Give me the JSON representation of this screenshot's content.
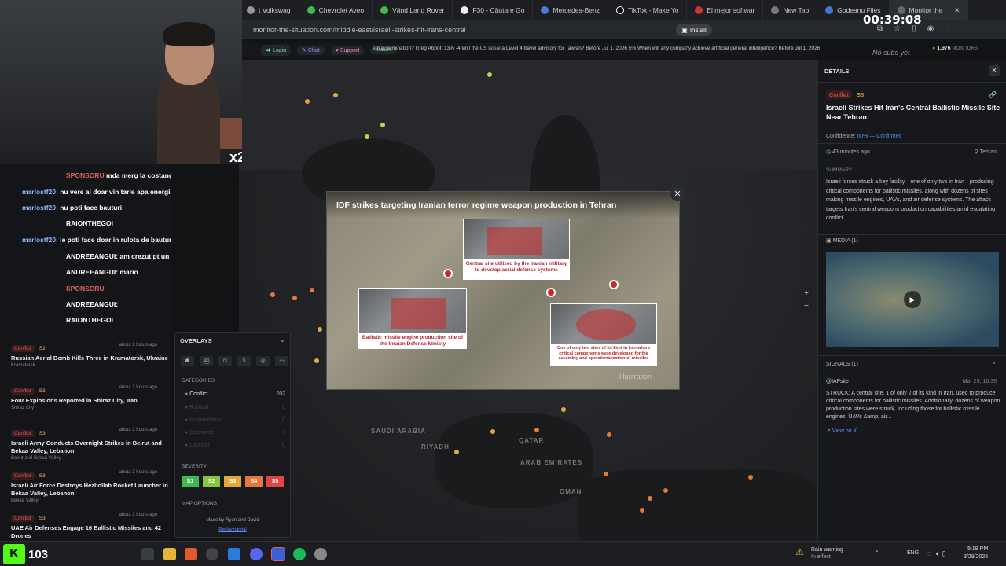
{
  "browser": {
    "tabs": [
      {
        "label": "t Volkswag"
      },
      {
        "label": "Chevrolet Aveo"
      },
      {
        "label": "Vând Land Rover"
      },
      {
        "label": "F30 - Căutare Go"
      },
      {
        "label": "Mercedes-Benz"
      },
      {
        "label": "TikTok - Make Yo"
      },
      {
        "label": "El mejor softwar"
      },
      {
        "label": "New Tab"
      },
      {
        "label": "Godeanu Files"
      },
      {
        "label": "Monitor the"
      }
    ],
    "url": "monitor-the-situation.com/middle-east/israeli-strikes-hit-irans-central",
    "install_label": "Install"
  },
  "stream": {
    "clock": "00:39:08",
    "multiplier": "x2",
    "no_subs": "No subs yet"
  },
  "site_nav": {
    "login": "Login",
    "chat": "Chat",
    "support": "Support",
    "kalshi": "KALSHI",
    "ticker": "ential nomination? Greg Abbott 13% -4   Will the US issue a Level 4 travel advisory for Taiwan? Before Jul 1, 2026 5%   When will any company achieve artificial general intelligence? Before Jul 1, 2026",
    "monitors_count": "1,976",
    "monitors_label": "MONITORS"
  },
  "chat": [
    {
      "user": "SPONSORU",
      "text": "mda merg la costangeles"
    },
    {
      "user": "marlostf20:",
      "text": "nu vere ai doar vin tarie apa energizante si bere"
    },
    {
      "user": "marlostf20:",
      "text": "nu poti face bauturi"
    },
    {
      "user": "RAIONTHEGOI",
      "text": ""
    },
    {
      "user": "marlostf20:",
      "text": "le poti face doar in rulota de bauturi"
    },
    {
      "user": "ANDREEANGUI:",
      "text": "am crezut pt un moment ca i marlo"
    },
    {
      "user": "ANDREEANGUI:",
      "text": "mario"
    },
    {
      "user": "SPONSORU",
      "text": ""
    },
    {
      "user": "ANDREEANGUI:",
      "text": ""
    },
    {
      "user": "RAIONTHEGOI",
      "text": ""
    }
  ],
  "feed": [
    {
      "tag": "Conflict",
      "sev": "S2",
      "ago": "about 2 hours ago",
      "title": "Russian Aerial Bomb Kills Three in Kramatorsk, Ukraine",
      "loc": "Kramatorsk"
    },
    {
      "tag": "Conflict",
      "sev": "S3",
      "ago": "about 2 hours ago",
      "title": "Four Explosions Reported in Shiraz City, Iran",
      "loc": "Shiraz City"
    },
    {
      "tag": "Conflict",
      "sev": "S3",
      "ago": "about 2 hours ago",
      "title": "Israeli Army Conducts Overnight Strikes in Beirut and Bekaa Valley, Lebanon",
      "loc": "Beirut and Bekaa Valley"
    },
    {
      "tag": "Conflict",
      "sev": "S3",
      "ago": "about 3 hours ago",
      "title": "Israeli Air Force Destroys Hezbollah Rocket Launcher in Bekaa Valley, Lebanon",
      "loc": "Bekaa Valley"
    },
    {
      "tag": "Conflict",
      "sev": "S3",
      "ago": "about 3 hours ago",
      "title": "UAE Air Defenses Engage 16 Ballistic Missiles and 42 Drones",
      "loc": ""
    }
  ],
  "overlays": {
    "title": "OVERLAYS",
    "categories_label": "CATEGORIES",
    "categories": [
      {
        "name": "Conflict",
        "count": "202"
      },
      {
        "name": "Political",
        "count": "0"
      },
      {
        "name": "Humanitarian",
        "count": "0"
      },
      {
        "name": "Economic",
        "count": "0"
      },
      {
        "name": "Disaster",
        "count": "0"
      }
    ],
    "severity_label": "SEVERITY",
    "severity": [
      "S1",
      "S2",
      "S3",
      "S4",
      "S5"
    ],
    "map_options": "MAP OPTIONS",
    "made_by": "Made by Ryan and David",
    "replay": "Replay tutorial"
  },
  "map_labels": [
    "SAUDI ARABIA",
    "RIYADH",
    "QATAR",
    "ARAB EMIRATES",
    "OMAN"
  ],
  "popup": {
    "title": "IDF strikes targeting Iranian terror regime weapon production in Tehran",
    "cap1": "Central site utilized by the Iranian military to develop aerial defense systems",
    "cap2": "Ballistic missile engine production site of the Irnaian Defense Ministy",
    "cap3": "One of only two sites of its kind in Iran where critical components were developed for the assembly and operationalization of missiles",
    "watermark": "Illustration"
  },
  "details": {
    "header": "DETAILS",
    "tag": "Conflict",
    "sev": "S3",
    "title": "Israeli Strikes Hit Iran's Central Ballistic Missile Site Near Tehran",
    "confidence_label": "Confidence:",
    "confidence_value": "60% — Confirmed",
    "time": "43 minutes ago",
    "place": "Tehran",
    "summary_label": "SUMMARY",
    "summary": "Israeli forces struck a key facility—one of only two in Iran—producing critical components for ballistic missiles, along with dozens of sites making missile engines, UAVs, and air defense systems. The attack targets Iran's central weapons production capabilities amid escalating conflict.",
    "media_label": "MEDIA (1)",
    "signals_label": "SIGNALS (1)",
    "signal_src": "@IAFsite",
    "signal_date": "Mar 29, 16:36",
    "signal_text": "STRUCK: A central site, 1 of only 2 of its kind in Iran, used to produce critical components for ballistic missiles. Additionally, dozens of weapon production sites were struck, including those for ballistic missile engines, UAVs &amp; air...",
    "view_on_x": "View on X"
  },
  "taskbar": {
    "viewers": "103",
    "weather_title": "Rain warning",
    "weather_sub": "In effect",
    "lang": "ENG",
    "time": "5:19 PM",
    "date": "3/29/2026"
  },
  "colors": {
    "accent": "#5b8cff",
    "conflict": "#e06060",
    "s1": "#3fb950",
    "s2": "#8ac43f",
    "s3": "#e5a93a",
    "s4": "#e5773a",
    "s5": "#e04545"
  }
}
